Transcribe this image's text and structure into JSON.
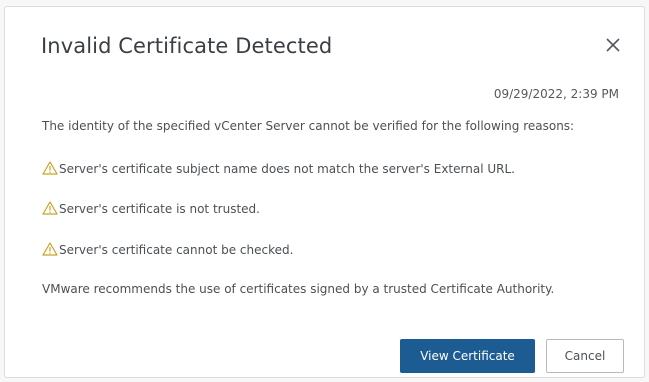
{
  "dialog": {
    "title": "Invalid Certificate Detected",
    "timestamp": "09/29/2022, 2:39 PM",
    "intro": "The identity of the specified vCenter Server cannot be verified for the following reasons:",
    "reasons": [
      "Server's certificate subject name does not match the server's External URL.",
      "Server's certificate is not trusted.",
      "Server's certificate cannot be checked."
    ],
    "recommendation": "VMware recommends the use of certificates signed by a trusted Certificate Authority.",
    "close_icon": "close-icon",
    "warning_icon": "warning-triangle-icon"
  },
  "buttons": {
    "view_certificate": "View Certificate",
    "cancel": "Cancel"
  },
  "colors": {
    "primary_button": "#1c5c93",
    "warning": "#c9a227"
  }
}
